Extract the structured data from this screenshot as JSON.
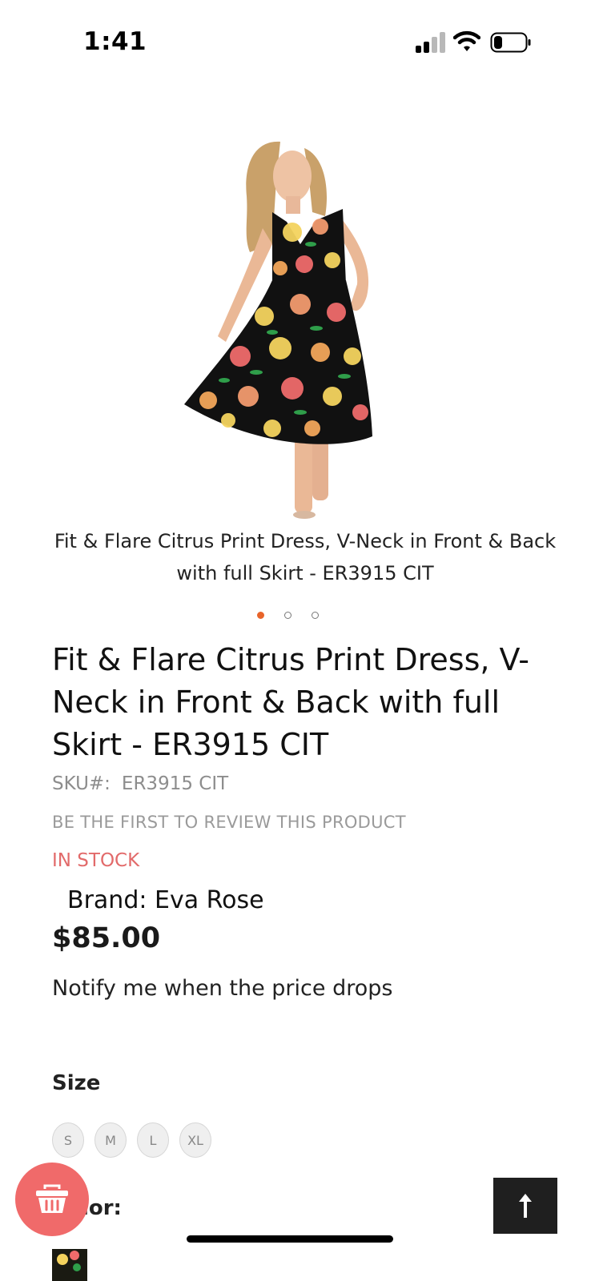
{
  "status_bar": {
    "time": "1:41",
    "signal_icon": "cellular-signal-icon",
    "wifi_icon": "wifi-icon",
    "battery_icon": "battery-icon",
    "signal_bars_active": 2,
    "signal_bars_total": 4,
    "battery_level": 0.2
  },
  "product": {
    "image_alt": "Fit & Flare Citrus Print Dress, V-Neck in Front & Back with full Skirt - ER3915 CIT",
    "image_caption": "Fit & Flare Citrus Print Dress, V-Neck in Front & Back with full Skirt - ER3915 CIT",
    "carousel": {
      "total": 3,
      "active_index": 0
    },
    "title": "Fit & Flare Citrus Print Dress, V-Neck in Front & Back with full Skirt - ER3915 CIT",
    "sku_label": "SKU#:",
    "sku_value": "ER3915 CIT",
    "review_link": "BE THE FIRST TO REVIEW THIS PRODUCT",
    "stock_status": "IN STOCK",
    "brand": "Brand: Eva Rose",
    "price": "$85.00",
    "notify_link": "Notify me when the price drops"
  },
  "options": {
    "size_label": "Size",
    "sizes": [
      "S",
      "M",
      "L",
      "XL"
    ],
    "color_label": "Color:"
  },
  "floating": {
    "cart_icon": "shopping-basket-icon",
    "back_to_top_icon": "arrow-up-icon"
  },
  "colors": {
    "accent_dot": "#e8642a",
    "stock_red": "#e26a6a",
    "cart_fab": "#f06a6a",
    "top_button": "#1f1f1f"
  }
}
